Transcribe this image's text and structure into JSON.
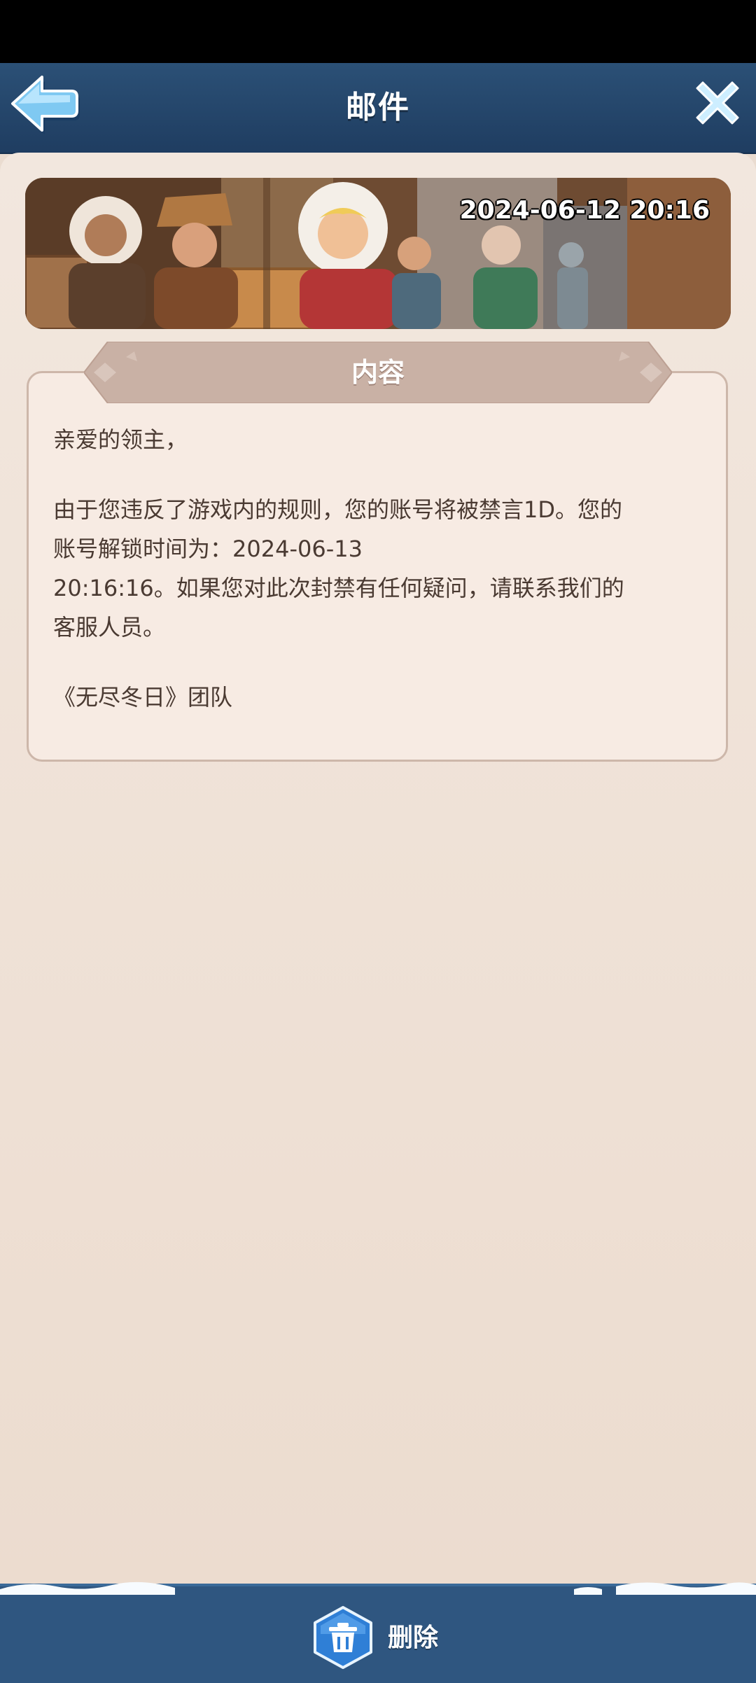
{
  "header": {
    "title": "邮件",
    "back_icon": "back-arrow-icon",
    "close_icon": "close-icon"
  },
  "mail": {
    "date": "2024-06-12 20:16",
    "section_title": "内容",
    "greeting": "亲爱的领主，",
    "body_line1": "由于您违反了游戏内的规则，您的账号将被禁言1D。您的",
    "body_line2": "账号解锁时间为：2024-06-13",
    "body_line3": "20:16:16。如果您对此次封禁有任何疑问，请联系我们的",
    "body_line4": "客服人员。",
    "signature": "《无尽冬日》团队"
  },
  "footer": {
    "delete_label": "删除",
    "delete_icon": "trash-icon"
  },
  "colors": {
    "top_bar": "#1f3d61",
    "paper": "#eadcd0",
    "panel_border": "#cdb7aa",
    "header_ribbon": "#c9b1a5",
    "text": "#4a3a32",
    "button_blue": "#2f7fd6"
  }
}
